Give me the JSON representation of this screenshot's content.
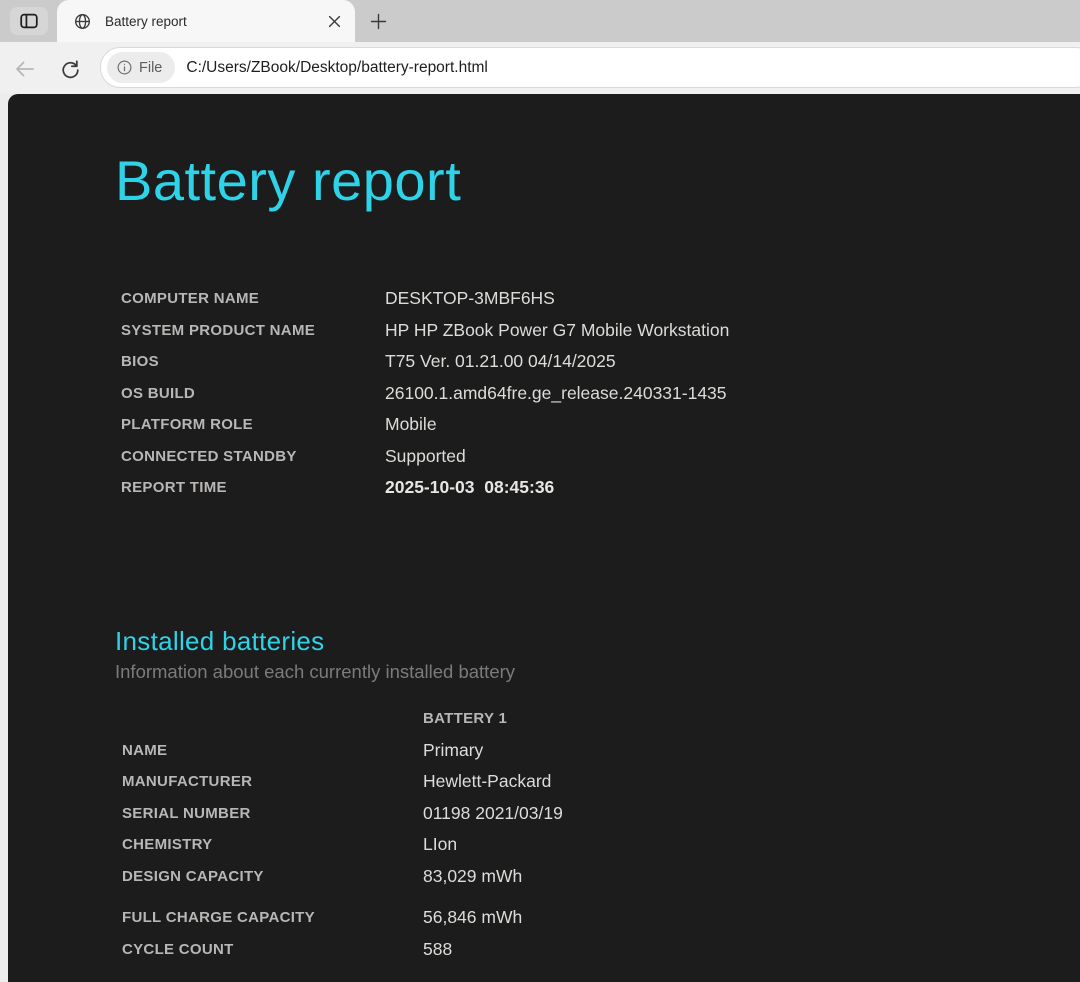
{
  "browser": {
    "tab_title": "Battery report",
    "file_badge_label": "File",
    "url": "C:/Users/ZBook/Desktop/battery-report.html",
    "icons": {
      "tab_actions": "tab-actions-icon",
      "favicon": "globe-icon",
      "close_tab": "close-icon",
      "new_tab": "plus-icon",
      "back": "arrow-left-icon",
      "refresh": "refresh-icon",
      "file_info": "info-icon"
    }
  },
  "page": {
    "title": "Battery report",
    "system_info": {
      "rows": [
        {
          "label": "COMPUTER NAME",
          "value": "DESKTOP-3MBF6HS"
        },
        {
          "label": "SYSTEM PRODUCT NAME",
          "value": "HP HP ZBook Power G7 Mobile Workstation"
        },
        {
          "label": "BIOS",
          "value": "T75 Ver. 01.21.00 04/14/2025"
        },
        {
          "label": "OS BUILD",
          "value": "26100.1.amd64fre.ge_release.240331-1435"
        },
        {
          "label": "PLATFORM ROLE",
          "value": "Mobile"
        },
        {
          "label": "CONNECTED STANDBY",
          "value": "Supported"
        },
        {
          "label": "REPORT TIME",
          "value": "2025-10-03  08:45:36"
        }
      ]
    },
    "installed_batteries": {
      "title": "Installed batteries",
      "subtitle": "Information about each currently installed battery",
      "column_header": "BATTERY 1",
      "rows": [
        {
          "label": "NAME",
          "value": "Primary"
        },
        {
          "label": "MANUFACTURER",
          "value": "Hewlett-Packard"
        },
        {
          "label": "SERIAL NUMBER",
          "value": "01198 2021/03/19"
        },
        {
          "label": "CHEMISTRY",
          "value": "LIon"
        },
        {
          "label": "DESIGN CAPACITY",
          "value": "83,029 mWh"
        },
        {
          "label": "FULL CHARGE CAPACITY",
          "value": "56,846 mWh"
        },
        {
          "label": "CYCLE COUNT",
          "value": "588"
        }
      ]
    }
  },
  "colors": {
    "accent_cyan": "#2fd3e8",
    "page_background": "#1c1c1c",
    "label_gray": "#b9b7b5",
    "value_white": "#dedcd9",
    "subtitle_gray": "#7d7b79",
    "tabbar_gray": "#cbcbcb",
    "toolbar_gray": "#f0f0f0"
  }
}
